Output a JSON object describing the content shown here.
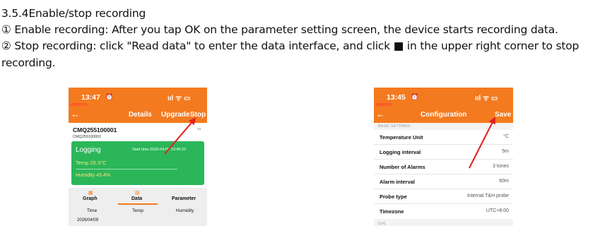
{
  "doc": {
    "heading": "3.5.4Enable/stop recording",
    "line1": "① Enable recording: After you tap OK on the parameter setting screen, the device starts recording data.",
    "line2": "② Stop recording: click \"Read data\" to enter the data interface, and click ■ in the upper right corner to stop",
    "line3": "recording."
  },
  "left_phone": {
    "status_time": "13:47",
    "status_icons": "ııl ᯤ ▭",
    "brand": "WEMYSS",
    "back_icon": "←",
    "title": "Details",
    "upgrade": "Upgrade",
    "stop": "Stop",
    "device_name": "CMQ255100001",
    "device_sub": "CMQ255100001",
    "more": "--",
    "status_label": "Logging",
    "start_time": "Start time 2026-04-09 13:46:22",
    "temp": "Temp  25.3°C",
    "humidity": "Humidity  45.4%",
    "tabs": [
      "Graph",
      "Data",
      "Parameter"
    ],
    "columns": [
      "Time",
      "Temp",
      "Humidity"
    ],
    "first_row": "2026/04/09",
    "colors": {
      "accent": "#f47a1f",
      "card": "#2bb659"
    }
  },
  "right_phone": {
    "status_time": "13:45",
    "status_icons": "ııl ᯤ ▭",
    "brand": "WEMYSS",
    "back_icon": "←",
    "title": "Configuration",
    "save": "Save",
    "section": "BASIC SETTINGS",
    "rows": [
      {
        "label": "Temperature Unit",
        "value": "°C"
      },
      {
        "label": "Logging interval",
        "value": "5m"
      },
      {
        "label": "Number of Alarms",
        "value": "3 tones"
      },
      {
        "label": "Alarm interval",
        "value": "60m"
      },
      {
        "label": "Probe type",
        "value": "Internal T&H probe"
      },
      {
        "label": "Timezone",
        "value": "UTC+8:00"
      }
    ],
    "section2": "CH1"
  }
}
